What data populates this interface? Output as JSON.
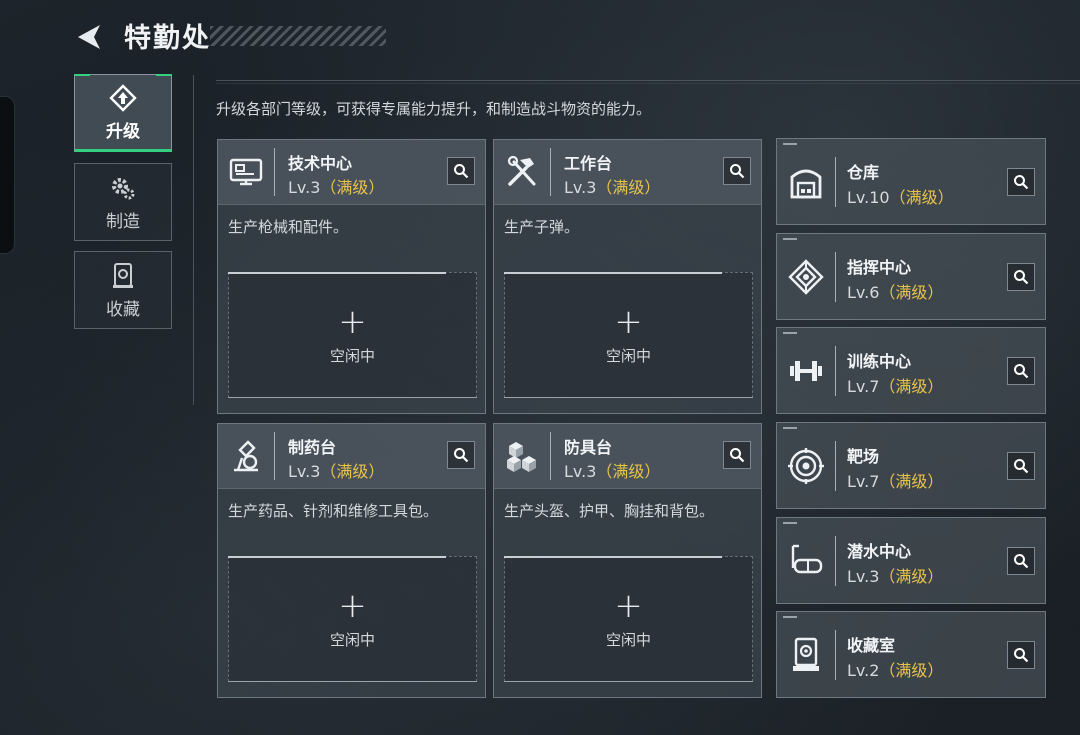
{
  "header": {
    "title": "特勤处"
  },
  "nav": [
    {
      "label": "升级",
      "icon": "upgrade-icon",
      "active": true
    },
    {
      "label": "制造",
      "icon": "gears-icon",
      "active": false
    },
    {
      "label": "收藏",
      "icon": "collection-icon",
      "active": false
    }
  ],
  "description": "升级各部门等级，可获得专属能力提升，和制造战斗物资的能力。",
  "cards": [
    {
      "name": "技术中心",
      "level": "Lv.3",
      "status": "（满级）",
      "desc": "生产枪械和配件。",
      "slot_plus": "+",
      "slot_label": "空闲中",
      "icon": "computer-icon"
    },
    {
      "name": "工作台",
      "level": "Lv.3",
      "status": "（满级）",
      "desc": "生产子弹。",
      "slot_plus": "+",
      "slot_label": "空闲中",
      "icon": "tools-icon"
    },
    {
      "name": "制药台",
      "level": "Lv.3",
      "status": "（满级）",
      "desc": "生产药品、针剂和维修工具包。",
      "slot_plus": "+",
      "slot_label": "空闲中",
      "icon": "microscope-icon"
    },
    {
      "name": "防具台",
      "level": "Lv.3",
      "status": "（满级）",
      "desc": "生产头盔、护甲、胸挂和背包。",
      "slot_plus": "+",
      "slot_label": "空闲中",
      "icon": "boxes-icon"
    }
  ],
  "side_cards": [
    {
      "name": "仓库",
      "level": "Lv.10",
      "status": "（满级）",
      "icon": "warehouse-icon"
    },
    {
      "name": "指挥中心",
      "level": "Lv.6",
      "status": "（满级）",
      "icon": "command-icon"
    },
    {
      "name": "训练中心",
      "level": "Lv.7",
      "status": "（满级）",
      "icon": "dumbbell-icon"
    },
    {
      "name": "靶场",
      "level": "Lv.7",
      "status": "（满级）",
      "icon": "target-icon"
    },
    {
      "name": "潜水中心",
      "level": "Lv.3",
      "status": "（满级）",
      "icon": "diving-mask-icon"
    },
    {
      "name": "收藏室",
      "level": "Lv.2",
      "status": "（满级）",
      "icon": "showcase-icon"
    }
  ],
  "colors": {
    "accent": "#35d07f",
    "maxed": "#e8c24a"
  }
}
